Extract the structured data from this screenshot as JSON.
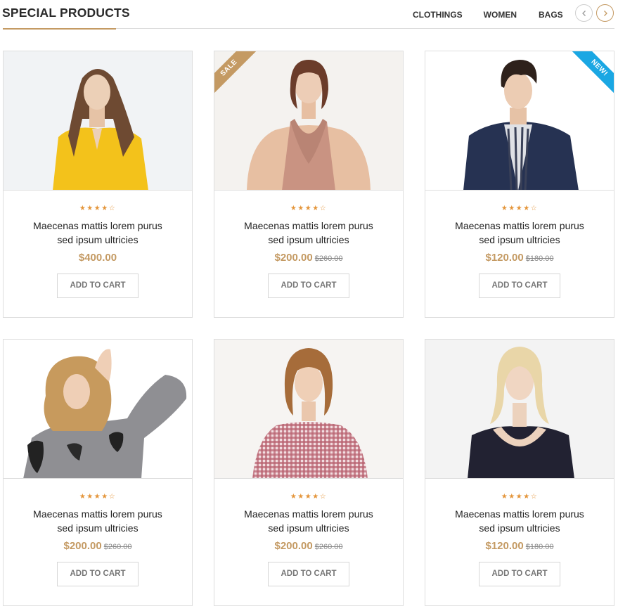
{
  "header": {
    "title": "SPECIAL PRODUCTS",
    "tabs": [
      "CLOTHINGS",
      "WOMEN",
      "BAGS"
    ],
    "prev_icon": "chevron-left-icon",
    "next_icon": "chevron-right-icon"
  },
  "colors": {
    "accent": "#c49a63",
    "star": "#e4953a",
    "new_badge": "#1aa7e3"
  },
  "products": [
    {
      "badge": "",
      "rating": 4,
      "stars": "★★★★☆",
      "name_line1": "Maecenas mattis lorem purus",
      "name_line2": "sed ipsum ultricies",
      "price": "$400.00",
      "old_price": "",
      "button": "ADD TO CART",
      "image": "woman in yellow top"
    },
    {
      "badge": "SALE",
      "rating": 4,
      "stars": "★★★★☆",
      "name_line1": "Maecenas mattis lorem purus",
      "name_line2": "sed ipsum ultricies",
      "price": "$200.00",
      "old_price": "$260.00",
      "button": "ADD TO CART",
      "image": "woman in pink lace top"
    },
    {
      "badge": "NEW!",
      "rating": 4,
      "stars": "★★★★☆",
      "name_line1": "Maecenas mattis lorem purus",
      "name_line2": "sed ipsum ultricies",
      "price": "$120.00",
      "old_price": "$180.00",
      "button": "ADD TO CART",
      "image": "man in navy jacket"
    },
    {
      "badge": "",
      "rating": 4,
      "stars": "★★★★☆",
      "name_line1": "Maecenas mattis lorem purus",
      "name_line2": "sed ipsum ultricies",
      "price": "$200.00",
      "old_price": "$260.00",
      "button": "ADD TO CART",
      "image": "woman in grey embroidered blouse"
    },
    {
      "badge": "",
      "rating": 4,
      "stars": "★★★★☆",
      "name_line1": "Maecenas mattis lorem purus",
      "name_line2": "sed ipsum ultricies",
      "price": "$200.00",
      "old_price": "$260.00",
      "button": "ADD TO CART",
      "image": "woman in red gingham top"
    },
    {
      "badge": "",
      "rating": 4,
      "stars": "★★★★☆",
      "name_line1": "Maecenas mattis lorem purus",
      "name_line2": "sed ipsum ultricies",
      "price": "$120.00",
      "old_price": "$180.00",
      "button": "ADD TO CART",
      "image": "woman in black wrap top"
    }
  ]
}
